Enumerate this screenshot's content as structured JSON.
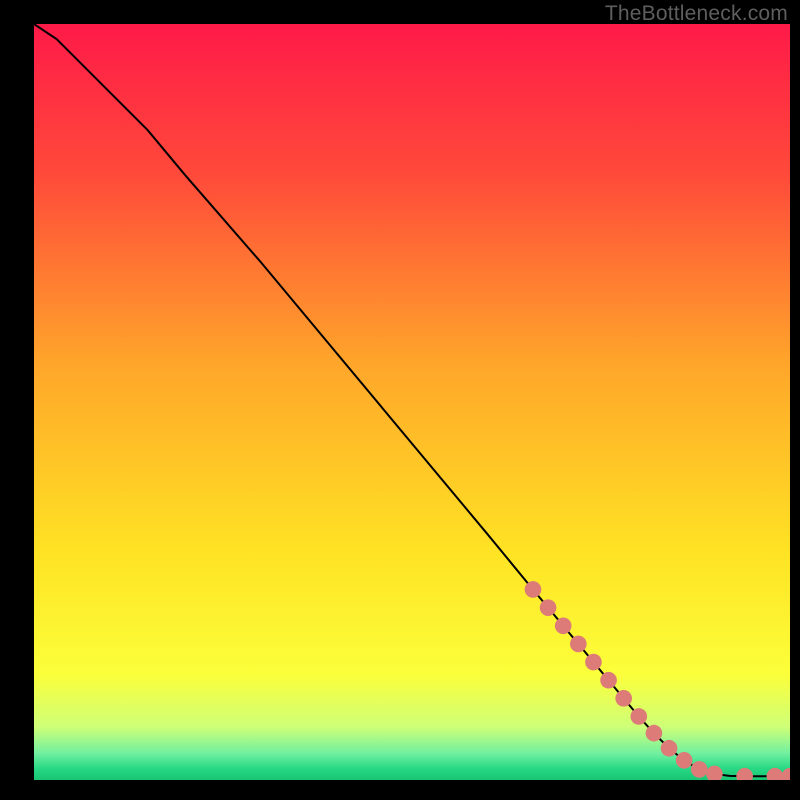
{
  "watermark": "TheBottleneck.com",
  "chart_data": {
    "type": "line",
    "title": "",
    "xlabel": "",
    "ylabel": "",
    "xlim": [
      0,
      100
    ],
    "ylim": [
      0,
      100
    ],
    "grid": false,
    "legend": "none",
    "gradient_stops": [
      {
        "offset": 0.0,
        "color": "#ff1a48"
      },
      {
        "offset": 0.2,
        "color": "#ff4a3a"
      },
      {
        "offset": 0.45,
        "color": "#ffa62a"
      },
      {
        "offset": 0.7,
        "color": "#ffe324"
      },
      {
        "offset": 0.86,
        "color": "#fbff3a"
      },
      {
        "offset": 0.93,
        "color": "#ceff78"
      },
      {
        "offset": 0.965,
        "color": "#70f0a0"
      },
      {
        "offset": 0.985,
        "color": "#27d884"
      },
      {
        "offset": 1.0,
        "color": "#18c573"
      }
    ],
    "series": [
      {
        "name": "curve",
        "color": "#000000",
        "x": [
          0,
          3,
          6,
          10,
          15,
          20,
          30,
          40,
          50,
          60,
          66,
          68,
          70,
          72,
          74,
          76,
          78,
          80,
          82,
          84,
          86,
          88,
          90,
          92,
          94,
          96,
          98,
          100
        ],
        "y": [
          100,
          98,
          95,
          91,
          86,
          80,
          68.5,
          56.5,
          44.5,
          32.5,
          25.2,
          22.8,
          20.4,
          18.0,
          15.6,
          13.2,
          10.8,
          8.4,
          6.2,
          4.2,
          2.6,
          1.4,
          0.8,
          0.55,
          0.5,
          0.5,
          0.5,
          0.5
        ]
      }
    ],
    "markers": {
      "name": "dots",
      "color": "#dd7b78",
      "radius_pct": 1.1,
      "x": [
        66,
        68,
        70,
        72,
        74,
        76,
        78,
        80,
        82,
        84,
        86,
        88,
        90,
        94,
        98,
        100
      ],
      "y": [
        25.2,
        22.8,
        20.4,
        18.0,
        15.6,
        13.2,
        10.8,
        8.4,
        6.2,
        4.2,
        2.6,
        1.4,
        0.8,
        0.5,
        0.5,
        0.5
      ]
    }
  }
}
